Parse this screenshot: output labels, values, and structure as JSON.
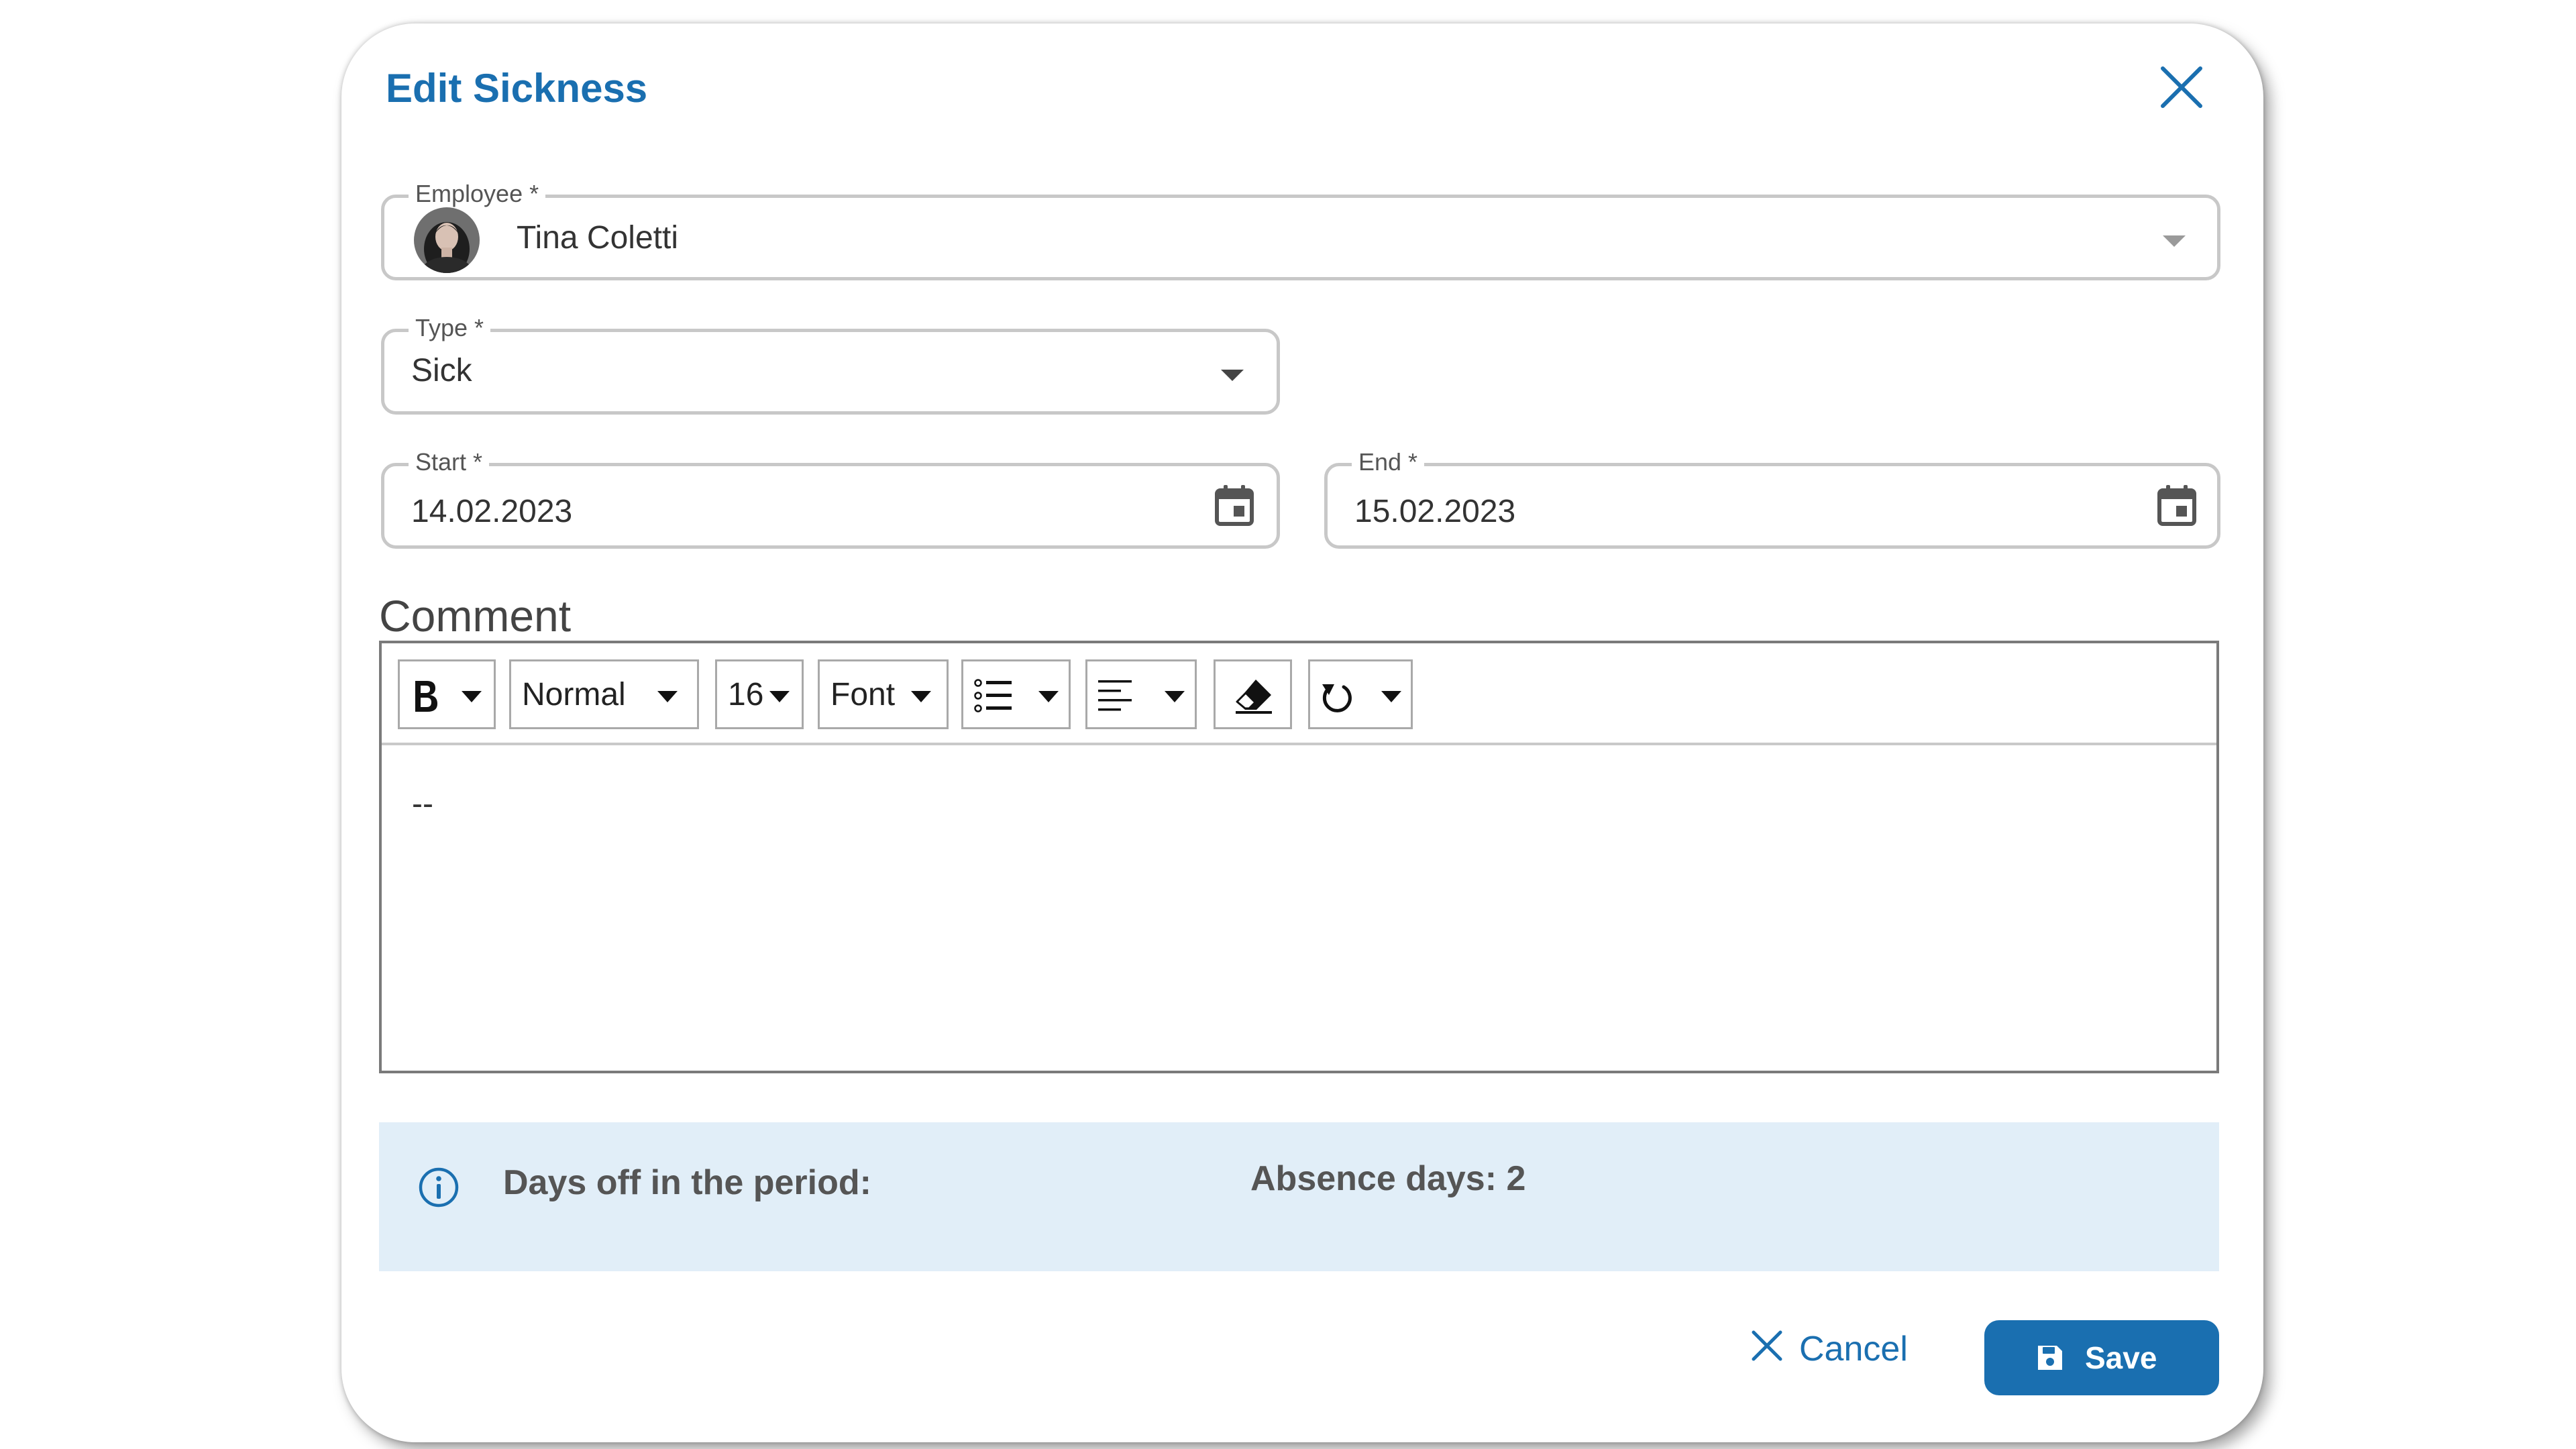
{
  "dialog": {
    "title": "Edit Sickness",
    "close_icon": "close-icon"
  },
  "employee": {
    "label": "Employee  *",
    "value": "Tina Coletti",
    "avatar_icon": "avatar",
    "arrow_icon": "chevron-down-icon"
  },
  "type": {
    "label": "Type  *",
    "value": "Sick",
    "arrow_icon": "chevron-down-icon"
  },
  "start": {
    "label": "Start  *",
    "value": "14.02.2023",
    "icon": "calendar-icon"
  },
  "end": {
    "label": "End *",
    "value": "15.02.2023",
    "icon": "calendar-icon"
  },
  "comment": {
    "label": "Comment",
    "content": "--",
    "toolbar": {
      "bold_icon": "bold-icon",
      "paragraph_style": "Normal",
      "font_size": "16",
      "font_family": "Font",
      "list_icon": "list-icon",
      "align_icon": "align-left-icon",
      "eraser_icon": "eraser-icon",
      "undo_icon": "undo-icon"
    }
  },
  "info": {
    "icon": "info-icon",
    "days_off_text": "Days off in the period:",
    "absence_text": "Absence days: 2"
  },
  "actions": {
    "cancel_label": "Cancel",
    "save_label": "Save"
  },
  "colors": {
    "accent": "#1a6fb0",
    "info_background": "#e1eef8",
    "field_border": "#c8c8c8"
  }
}
